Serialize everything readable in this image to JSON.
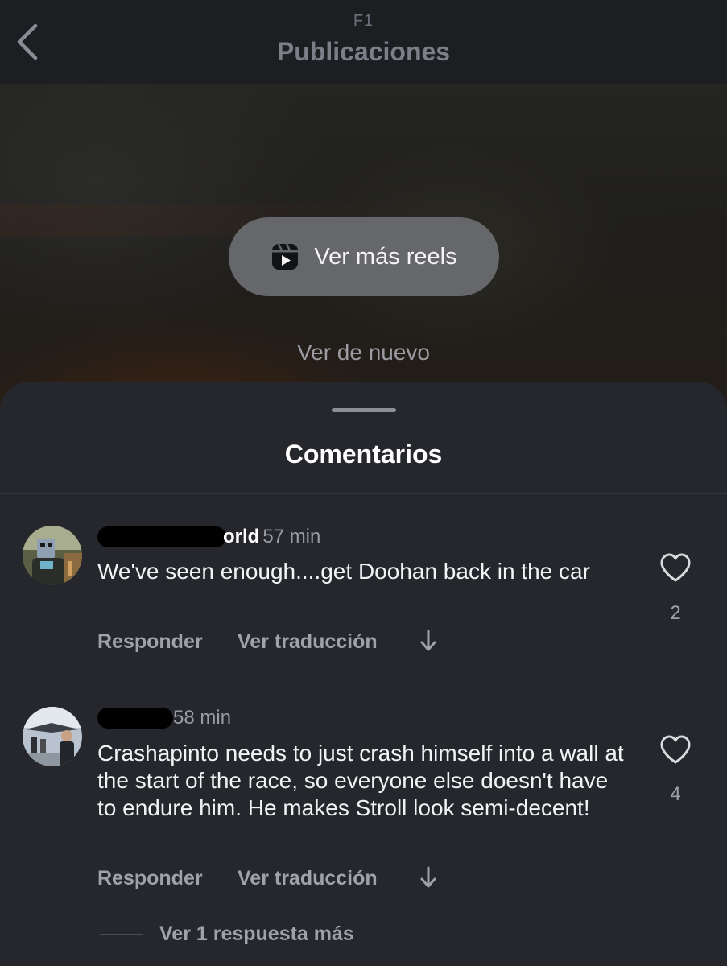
{
  "header": {
    "account": "F1",
    "title": "Publicaciones"
  },
  "video": {
    "reels_button_label": "Ver más reels",
    "replay_label": "Ver de nuevo"
  },
  "comments_sheet": {
    "title": "Comentarios",
    "comments": [
      {
        "username_visible": "orld",
        "time": "57 min",
        "text": "We've seen enough....get Doohan back in the car",
        "likes": "2",
        "reply_label": "Responder",
        "translate_label": "Ver traducción"
      },
      {
        "username_visible": "",
        "time": "58 min",
        "text": "Crashapinto needs to just crash himself into a wall at the start of the race, so everyone else doesn't have to endure him. He makes Stroll look semi-decent!",
        "likes": "4",
        "reply_label": "Responder",
        "translate_label": "Ver traducción",
        "more_replies_label": "Ver 1 respuesta más"
      }
    ]
  },
  "colors": {
    "sheet_background": "#25272c",
    "header_background": "#1c1e22",
    "muted_text": "#9fa2a8",
    "reels_button": "#66676b"
  },
  "icons": [
    "back-chevron-icon",
    "reels-icon",
    "heart-icon",
    "arrow-down-icon"
  ]
}
